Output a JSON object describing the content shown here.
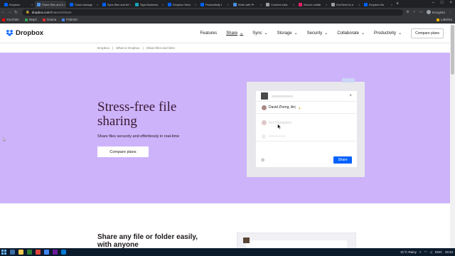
{
  "browser": {
    "tabs": [
      {
        "title": "Dropbox",
        "active": false
      },
      {
        "title": "Share files and folders",
        "active": true
      },
      {
        "title": "Cloud storage",
        "active": false
      },
      {
        "title": "Sync files and fold",
        "active": false
      },
      {
        "title": "Sign Business",
        "active": false
      },
      {
        "title": "Dropbox Secu",
        "active": false
      },
      {
        "title": "Productivity t",
        "active": false
      },
      {
        "title": "Work with Pr",
        "active": false
      },
      {
        "title": "Content colla",
        "active": false
      },
      {
        "title": "Secure collab",
        "active": false
      },
      {
        "title": "DocSend is a",
        "active": false
      },
      {
        "title": "Dropbox Bu",
        "active": false
      }
    ],
    "new_tab": "+",
    "url_host": "dropbox.com",
    "url_path": "/features/share",
    "incognito_label": "Incognito",
    "bookmarks": [
      "YouTube",
      "Maps",
      "Gaana",
      "Pabmet"
    ],
    "bookmarks_right": "Lakshra"
  },
  "nav": {
    "logo": "Dropbox",
    "items": [
      {
        "label": "Features",
        "chevron": false
      },
      {
        "label": "Share",
        "chevron": true
      },
      {
        "label": "Sync",
        "chevron": true
      },
      {
        "label": "Storage",
        "chevron": true
      },
      {
        "label": "Security",
        "chevron": true
      },
      {
        "label": "Collaborate",
        "chevron": true
      },
      {
        "label": "Productivity",
        "chevron": true
      }
    ],
    "compare_button": "Compare plans",
    "chevron": "⌄"
  },
  "breadcrumb": [
    "Dropbox",
    "What is Dropbox",
    "Share files and links"
  ],
  "breadcrumb_sep": "|",
  "hero": {
    "title": "Stress-free file sharing",
    "subtitle": "Share files securely and effortlessly in real-time",
    "button": "Compare plans"
  },
  "dialog": {
    "close": "×",
    "person1": "David Zheng, An",
    "caret": "|",
    "person2": "Fel Thompson",
    "share_button": "Share",
    "gear": "⚙"
  },
  "section2": {
    "title": "Share any file or folder easily, with anyone"
  },
  "taskbar": {
    "weather": "31°C  Rainy",
    "lang": "ENG",
    "time": "19:34"
  },
  "colors": {
    "brand": "#0061fe",
    "hero_bg": "#cdb3fa",
    "hero_title": "#3b1a33"
  }
}
